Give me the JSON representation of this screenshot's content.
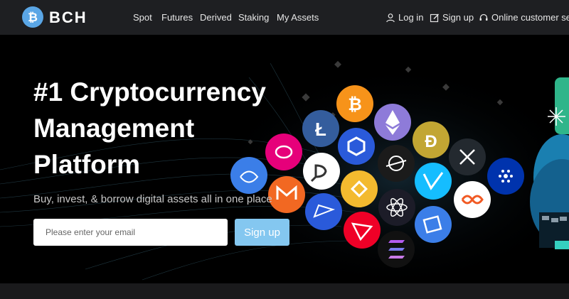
{
  "brand": {
    "name": "BCH",
    "logo_icon": "bitcoin-icon",
    "logo_color": "#5aa6e6"
  },
  "nav": {
    "items": [
      {
        "label": "Spot"
      },
      {
        "label": "Futures"
      },
      {
        "label": "Derived"
      },
      {
        "label": "Staking"
      },
      {
        "label": "My Assets"
      }
    ],
    "login": {
      "label": "Log in",
      "icon": "user-icon"
    },
    "signup": {
      "label": "Sign up",
      "icon": "edit-icon"
    },
    "support": {
      "label": "Online customer service",
      "icon": "headset-icon"
    }
  },
  "hero": {
    "title": "#1 Cryptocurrency Management Platform",
    "subtitle": "Buy, invest, & borrow digital assets all in one place",
    "email_placeholder": "Please enter your email",
    "signup_label": "Sign up"
  },
  "colors": {
    "header_bg": "#1e1f22",
    "accent_button": "#84c7f0",
    "hero_bg": "#000000"
  },
  "coins": [
    {
      "name": "bitcoin-coin-icon",
      "color": "#f7931a"
    },
    {
      "name": "ethereum-coin-icon",
      "color": "#8e7bd9"
    },
    {
      "name": "litecoin-coin-icon",
      "color": "#345d9d"
    },
    {
      "name": "chainlink-coin-icon",
      "color": "#2a5ada"
    },
    {
      "name": "dogecoin-coin-icon",
      "color": "#c2a633"
    },
    {
      "name": "polkadot-coin-icon",
      "color": "#e6007a"
    },
    {
      "name": "dfinity-coin-icon",
      "color": "#ffffff"
    },
    {
      "name": "stellar-coin-icon",
      "color": "#1b1b1b"
    },
    {
      "name": "xrp-coin-icon",
      "color": "#23292f"
    },
    {
      "name": "cardano-coin-icon",
      "color": "#0033ad"
    },
    {
      "name": "fetch-coin-icon",
      "color": "#3b7ee8"
    },
    {
      "name": "binance-coin-icon",
      "color": "#f3ba2f"
    },
    {
      "name": "vechain-coin-icon",
      "color": "#15bdff"
    },
    {
      "name": "monero-coin-icon",
      "color": "#f26822"
    },
    {
      "name": "cosmos-coin-icon",
      "color": "#2e3148"
    },
    {
      "name": "internet-computer-coin-icon",
      "color": "#ffffff"
    },
    {
      "name": "nano-coin-icon",
      "color": "#2a5ada"
    },
    {
      "name": "tron-coin-icon",
      "color": "#ef0027"
    },
    {
      "name": "algorand-coin-icon",
      "color": "#3b7ee8"
    },
    {
      "name": "solana-coin-icon",
      "color": "#111111"
    }
  ]
}
